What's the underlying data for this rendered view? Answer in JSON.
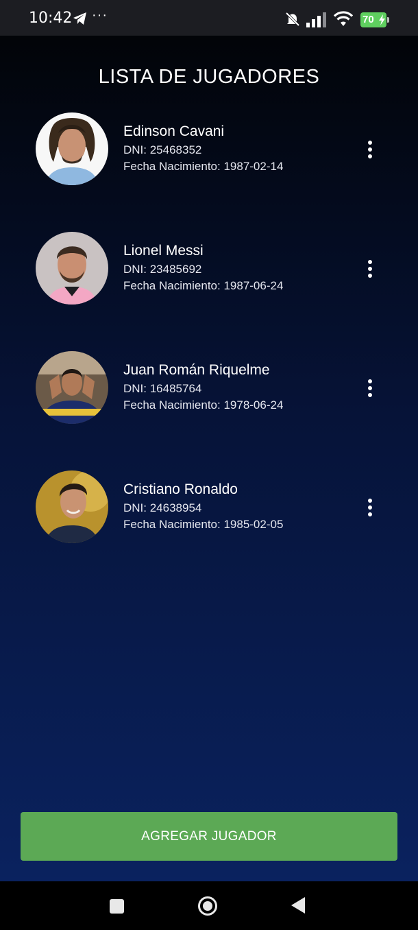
{
  "status_bar": {
    "time": "10:42",
    "battery_level": "70",
    "icons": [
      "telegram-icon",
      "more-dots-icon",
      "mute-icon",
      "signal-icon",
      "wifi-icon",
      "battery-charging-icon"
    ],
    "battery_color": "#5fcf5f"
  },
  "page": {
    "title": "LISTA DE JUGADORES"
  },
  "players": [
    {
      "name": "Edinson Cavani",
      "dni": "DNI: 25468352",
      "dob": "Fecha Nacimiento: 1987-02-14"
    },
    {
      "name": "Lionel Messi",
      "dni": "DNI: 23485692",
      "dob": "Fecha Nacimiento: 1987-06-24"
    },
    {
      "name": "Juan Román Riquelme",
      "dni": "DNI: 16485764",
      "dob": "Fecha Nacimiento: 1978-06-24"
    },
    {
      "name": "Cristiano Ronaldo",
      "dni": "DNI: 24638954",
      "dob": "Fecha Nacimiento: 1985-02-05"
    }
  ],
  "actions": {
    "add_label": "AGREGAR JUGADOR",
    "add_color": "#5ca955"
  },
  "nav_bar": {
    "icons": [
      "recents-icon",
      "home-icon",
      "back-icon"
    ]
  }
}
